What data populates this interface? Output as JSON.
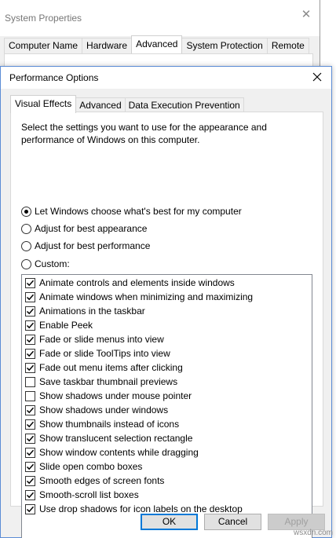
{
  "background_window": {
    "title": "System Properties",
    "tabs": [
      {
        "label": "Computer Name",
        "active": false
      },
      {
        "label": "Hardware",
        "active": false
      },
      {
        "label": "Advanced",
        "active": true
      },
      {
        "label": "System Protection",
        "active": false
      },
      {
        "label": "Remote",
        "active": false
      }
    ]
  },
  "dialog": {
    "title": "Performance Options",
    "tabs": [
      {
        "label": "Visual Effects",
        "active": true
      },
      {
        "label": "Advanced",
        "active": false
      },
      {
        "label": "Data Execution Prevention",
        "active": false
      }
    ],
    "description": "Select the settings you want to use for the appearance and performance of Windows on this computer.",
    "radios": [
      {
        "label": "Let Windows choose what's best for my computer",
        "checked": true
      },
      {
        "label": "Adjust for best appearance",
        "checked": false
      },
      {
        "label": "Adjust for best performance",
        "checked": false
      },
      {
        "label": "Custom:",
        "checked": false
      }
    ],
    "effects": [
      {
        "label": "Animate controls and elements inside windows",
        "checked": true
      },
      {
        "label": "Animate windows when minimizing and maximizing",
        "checked": true
      },
      {
        "label": "Animations in the taskbar",
        "checked": true
      },
      {
        "label": "Enable Peek",
        "checked": true
      },
      {
        "label": "Fade or slide menus into view",
        "checked": true
      },
      {
        "label": "Fade or slide ToolTips into view",
        "checked": true
      },
      {
        "label": "Fade out menu items after clicking",
        "checked": true
      },
      {
        "label": "Save taskbar thumbnail previews",
        "checked": false
      },
      {
        "label": "Show shadows under mouse pointer",
        "checked": false
      },
      {
        "label": "Show shadows under windows",
        "checked": true
      },
      {
        "label": "Show thumbnails instead of icons",
        "checked": true
      },
      {
        "label": "Show translucent selection rectangle",
        "checked": true
      },
      {
        "label": "Show window contents while dragging",
        "checked": true
      },
      {
        "label": "Slide open combo boxes",
        "checked": true
      },
      {
        "label": "Smooth edges of screen fonts",
        "checked": true
      },
      {
        "label": "Smooth-scroll list boxes",
        "checked": true
      },
      {
        "label": "Use drop shadows for icon labels on the desktop",
        "checked": true
      }
    ],
    "buttons": {
      "ok": "OK",
      "cancel": "Cancel",
      "apply": "Apply"
    }
  },
  "watermark": "wsxdn.com",
  "colors": {
    "accent": "#0078d7",
    "dialog_border": "#5b8cd6"
  }
}
